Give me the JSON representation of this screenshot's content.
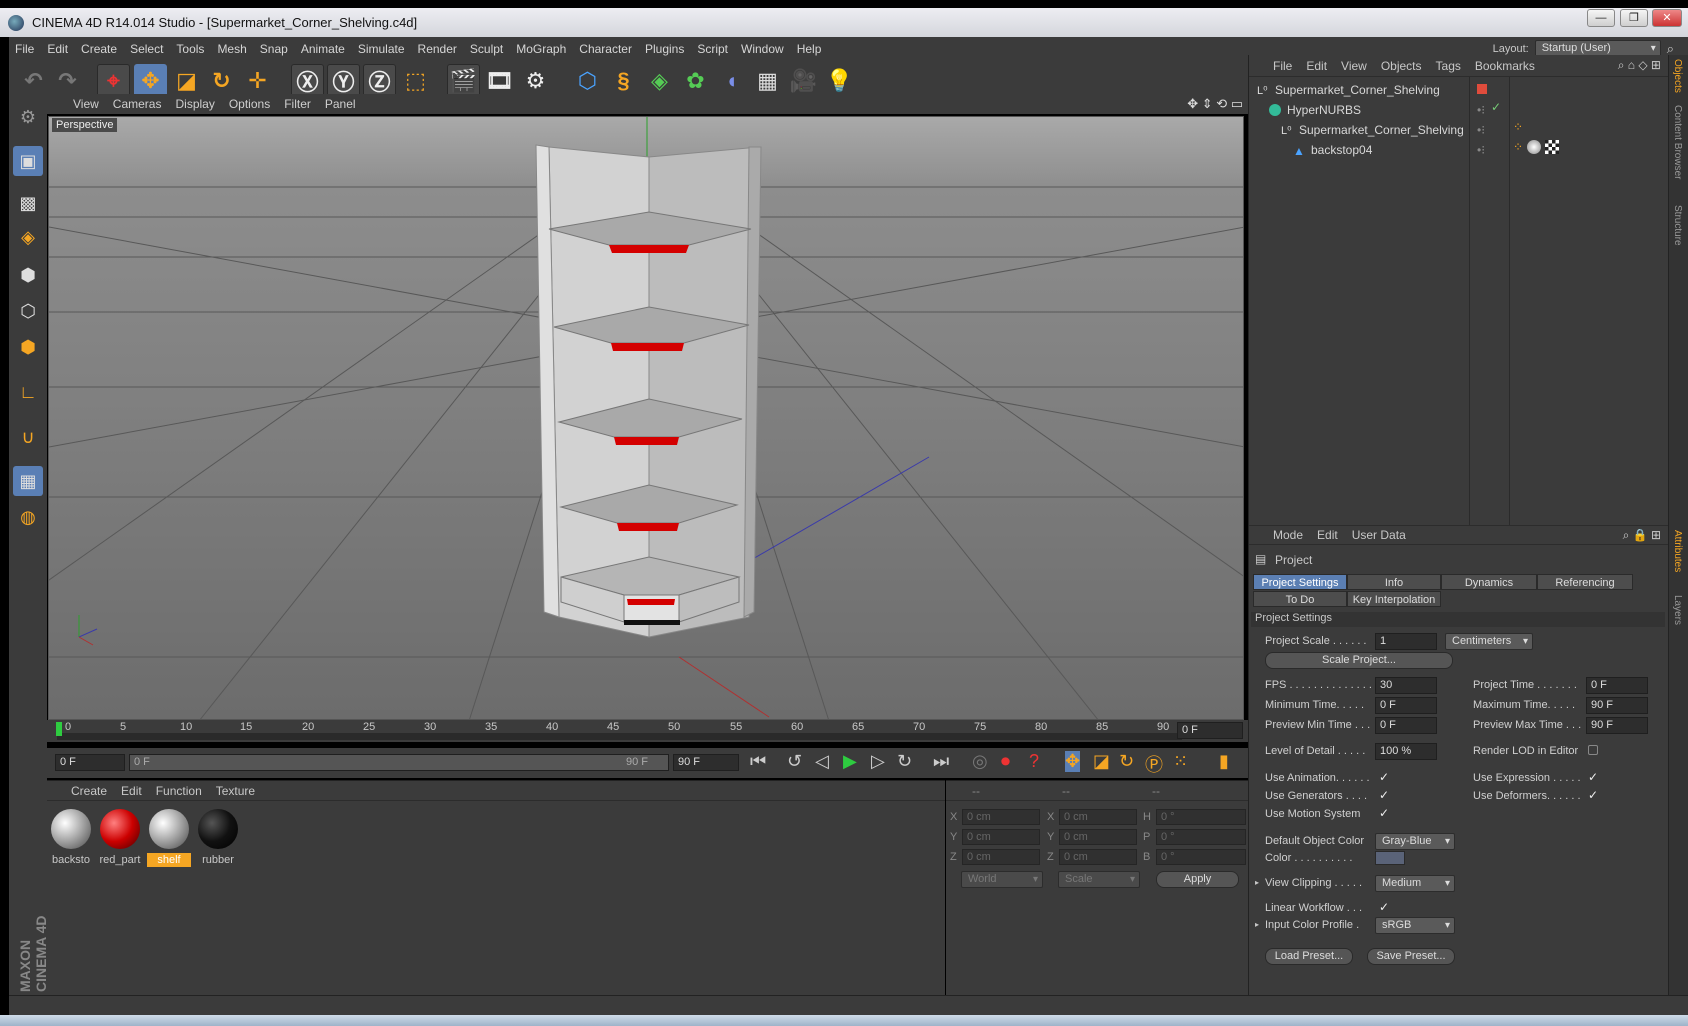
{
  "app": {
    "title": "CINEMA 4D R14.014 Studio - [Supermarket_Corner_Shelving.c4d]",
    "window_buttons": [
      "—",
      "❐",
      "✕"
    ]
  },
  "menubar": {
    "items": [
      "File",
      "Edit",
      "Create",
      "Select",
      "Tools",
      "Mesh",
      "Snap",
      "Animate",
      "Simulate",
      "Render",
      "Sculpt",
      "MoGraph",
      "Character",
      "Plugins",
      "Script",
      "Window",
      "Help"
    ],
    "layout_label": "Layout:",
    "layout_value": "Startup (User)"
  },
  "viewport": {
    "menu": [
      "View",
      "Cameras",
      "Display",
      "Options",
      "Filter",
      "Panel"
    ],
    "label": "Perspective",
    "colors": {
      "shelf": "#c9c9c9",
      "accent": "#d40000",
      "axis_y": "#2ca02c",
      "axis_z": "#3a3aaa",
      "axis_x": "#b03030"
    }
  },
  "timeline": {
    "ticks": [
      "0",
      "5",
      "10",
      "15",
      "20",
      "25",
      "30",
      "35",
      "40",
      "45",
      "50",
      "55",
      "60",
      "65",
      "70",
      "75",
      "80",
      "85",
      "90"
    ],
    "current_frame": "0 F"
  },
  "transport": {
    "start": "0 F",
    "range_start": "0 F",
    "range_end": "90 F",
    "end": "90 F"
  },
  "materials": {
    "menu": [
      "Create",
      "Edit",
      "Function",
      "Texture"
    ],
    "items": [
      {
        "label": "backsto",
        "color": "white"
      },
      {
        "label": "red_part",
        "color": "red"
      },
      {
        "label": "shelf",
        "color": "white",
        "selected": true
      },
      {
        "label": "rubber",
        "color": "black"
      }
    ]
  },
  "coords": {
    "headers": [
      "--",
      "--",
      "--"
    ],
    "rows": [
      {
        "a": "X",
        "av": "0 cm",
        "b": "X",
        "bv": "0 cm",
        "c": "H",
        "cv": "0 °"
      },
      {
        "a": "Y",
        "av": "0 cm",
        "b": "Y",
        "bv": "0 cm",
        "c": "P",
        "cv": "0 °"
      },
      {
        "a": "Z",
        "av": "0 cm",
        "b": "Z",
        "bv": "0 cm",
        "c": "B",
        "cv": "0 °"
      }
    ],
    "world": "World",
    "scale": "Scale",
    "apply": "Apply"
  },
  "objects": {
    "menu": [
      "File",
      "Edit",
      "View",
      "Objects",
      "Tags",
      "Bookmarks"
    ],
    "tree": [
      {
        "name": "Supermarket_Corner_Shelving",
        "indent": 0
      },
      {
        "name": "HyperNURBS",
        "indent": 1
      },
      {
        "name": "Supermarket_Corner_Shelving",
        "indent": 2
      },
      {
        "name": "backstop04",
        "indent": 3
      }
    ]
  },
  "attributes": {
    "menu": [
      "Mode",
      "Edit",
      "User Data"
    ],
    "object": "Project",
    "tabs": [
      "Project Settings",
      "Info",
      "Dynamics",
      "Referencing"
    ],
    "tabs2": [
      "To Do",
      "Key Interpolation"
    ],
    "section": "Project Settings",
    "project_scale_label": "Project Scale . . . . . .",
    "project_scale": "1",
    "units": "Centimeters",
    "scale_project_btn": "Scale Project...",
    "fps_label": "FPS . . . . . . . . . . . . . .",
    "fps": "30",
    "project_time_label": "Project Time . . . . . . .",
    "project_time": "0 F",
    "min_time_label": "Minimum Time. . . . .",
    "min_time": "0 F",
    "max_time_label": "Maximum Time. . . . .",
    "max_time": "90 F",
    "prev_min_label": "Preview Min Time . . .",
    "prev_min": "0 F",
    "prev_max_label": "Preview Max Time . . .",
    "prev_max": "90 F",
    "lod_label": "Level of Detail . . . . .",
    "lod": "100 %",
    "render_lod_label": "Render LOD in Editor",
    "use_anim_label": "Use Animation. . . . . .",
    "use_expr_label": "Use Expression . . . . .",
    "use_gen_label": "Use Generators . . . .",
    "use_def_label": "Use Deformers. . . . . .",
    "use_motion_label": "Use Motion System",
    "def_obj_color_label": "Default Object Color",
    "def_obj_color": "Gray-Blue",
    "color_label": "Color . . . . . . . . . .",
    "view_clip_label": "View Clipping . . . . .",
    "view_clip": "Medium",
    "linear_wf_label": "Linear Workflow . . .",
    "input_profile_label": "Input Color Profile .",
    "input_profile": "sRGB",
    "load_preset": "Load Preset...",
    "save_preset": "Save Preset...",
    "check": "✓"
  },
  "side_tabs": [
    "Objects",
    "Content Browser",
    "Structure",
    "Attributes",
    "Layers"
  ],
  "brand": "MAXON CINEMA 4D"
}
